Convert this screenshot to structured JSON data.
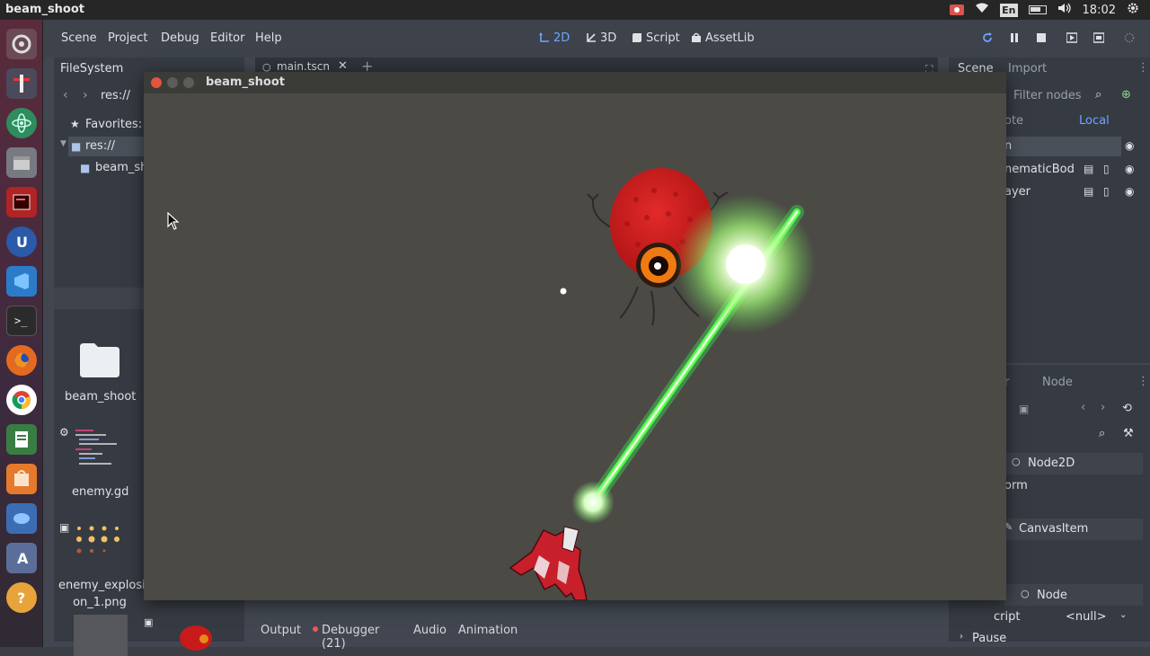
{
  "topbar": {
    "window_title": "beam_shoot",
    "lang": "En",
    "clock": "18:02"
  },
  "launcher": {
    "apps": [
      "home-icon",
      "text-editor-icon",
      "atom-icon",
      "files-icon",
      "terminal-red-icon",
      "unreal-icon",
      "vscode-icon",
      "terminal-icon",
      "firefox-icon",
      "chrome-icon",
      "libreoffice-icon",
      "software-icon",
      "help-icon"
    ]
  },
  "menubar": {
    "scene": "Scene",
    "project": "Project",
    "debug": "Debug",
    "editor": "Editor",
    "help": "Help",
    "ws_2d": "2D",
    "ws_3d": "3D",
    "ws_script": "Script",
    "ws_assetlib": "AssetLib"
  },
  "filesystem": {
    "title": "FileSystem",
    "path": "res://",
    "favorites": "Favorites:",
    "res_root": "res://",
    "folder": "beam_sh",
    "items": [
      {
        "label": "beam_shoot"
      },
      {
        "label": "enemy.gd"
      },
      {
        "label": "enemy_explosi on_1.png"
      }
    ]
  },
  "tabs": {
    "main_tab": "main.tscn"
  },
  "scene_dock": {
    "scene_tab": "Scene",
    "import_tab": "Import",
    "filter_placeholder": "Filter nodes",
    "remote": "ote",
    "local": "Local",
    "nodes": [
      "n",
      "nematicBod",
      "ayer"
    ]
  },
  "inspector": {
    "tab_r": "r",
    "node_tab": "Node",
    "class_node2d": "Node2D",
    "transform": "orm",
    "canvas_item": "CanvasItem",
    "node_class": "Node",
    "script_label": "cript",
    "script_value": "<null>",
    "pause": "Pause"
  },
  "game_window": {
    "title": "beam_shoot"
  },
  "bottom_panel": {
    "output": "Output",
    "debugger": "Debugger (21)",
    "audio": "Audio",
    "animation": "Animation"
  },
  "colors": {
    "accent": "#6ca6ff",
    "beam": "#3dff5a",
    "enemy_red": "#d01c1c"
  }
}
